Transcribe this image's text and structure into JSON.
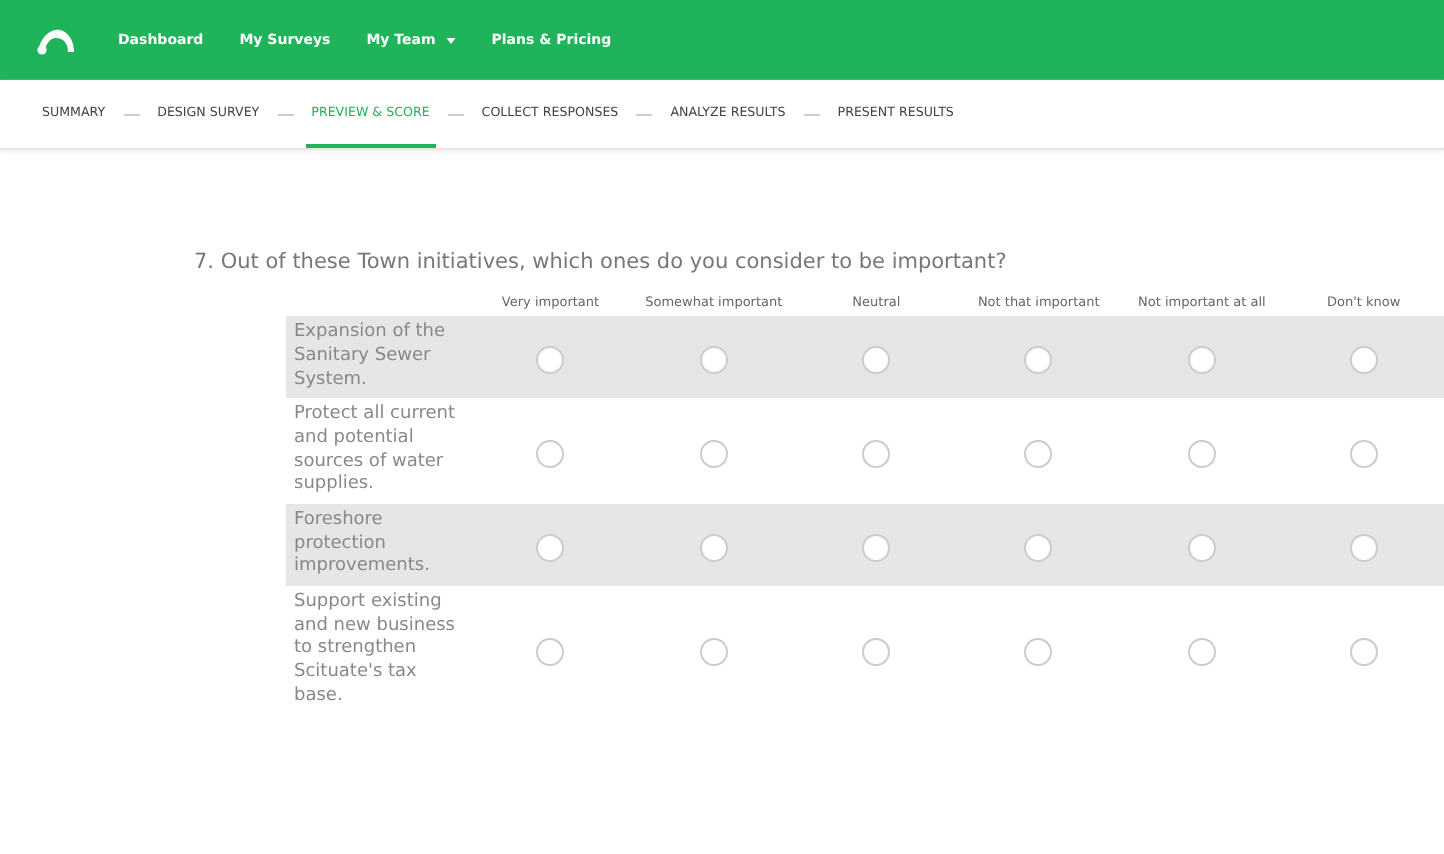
{
  "nav": {
    "items": [
      {
        "label": "Dashboard",
        "dropdown": false
      },
      {
        "label": "My Surveys",
        "dropdown": false
      },
      {
        "label": "My Team",
        "dropdown": true
      },
      {
        "label": "Plans & Pricing",
        "dropdown": false
      }
    ]
  },
  "steps": [
    {
      "label": "SUMMARY",
      "selected": false
    },
    {
      "label": "DESIGN SURVEY",
      "selected": false
    },
    {
      "label": "PREVIEW & SCORE",
      "selected": true
    },
    {
      "label": "COLLECT RESPONSES",
      "selected": false
    },
    {
      "label": "ANALYZE RESULTS",
      "selected": false
    },
    {
      "label": "PRESENT RESULTS",
      "selected": false
    }
  ],
  "question": {
    "title": "7. Out of these Town initiatives, which ones do you consider to be important?",
    "columns": [
      "Very important",
      "Somewhat important",
      "Neutral",
      "Not that important",
      "Not important at all",
      "Don't know"
    ],
    "rows": [
      {
        "label": "Expansion of the Sanitary Sewer System.",
        "options": [
          {
            "selected": false
          },
          {
            "selected": false
          },
          {
            "selected": false
          },
          {
            "selected": false
          },
          {
            "selected": false
          },
          {
            "selected": false
          }
        ]
      },
      {
        "label": "Protect all current and potential sources of water supplies.",
        "options": [
          {
            "selected": false
          },
          {
            "selected": false
          },
          {
            "selected": false
          },
          {
            "selected": false
          },
          {
            "selected": false
          },
          {
            "selected": false
          }
        ]
      },
      {
        "label": "Foreshore protection improvements.",
        "options": [
          {
            "selected": false
          },
          {
            "selected": false
          },
          {
            "selected": false
          },
          {
            "selected": false
          },
          {
            "selected": false
          },
          {
            "selected": false
          }
        ]
      },
      {
        "label": "Support existing and new business to strengthen Scituate's tax base.",
        "options": [
          {
            "selected": false
          },
          {
            "selected": false
          },
          {
            "selected": false
          },
          {
            "selected": false
          },
          {
            "selected": false
          },
          {
            "selected": false
          }
        ]
      }
    ]
  }
}
